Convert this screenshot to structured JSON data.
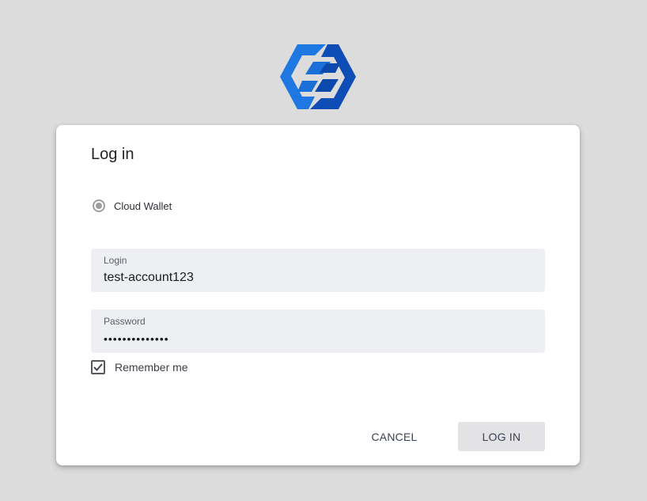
{
  "logo": {
    "icon": "hexagon-logo-icon",
    "colors": [
      "#1f75e0",
      "#0e4bb4"
    ]
  },
  "dialog": {
    "title": "Log in",
    "wallet_option": {
      "label": "Cloud Wallet",
      "selected": true
    },
    "login_field": {
      "label": "Login",
      "value": "test-account123"
    },
    "password_field": {
      "label": "Password",
      "value": "••••••••••••••"
    },
    "remember_me": {
      "label": "Remember me",
      "checked": true
    },
    "buttons": {
      "cancel": "CANCEL",
      "login": "LOG IN"
    }
  },
  "colors": {
    "background": "#dcdcdd",
    "field_background": "#eeeff3",
    "button_background": "#e3e3e5"
  }
}
